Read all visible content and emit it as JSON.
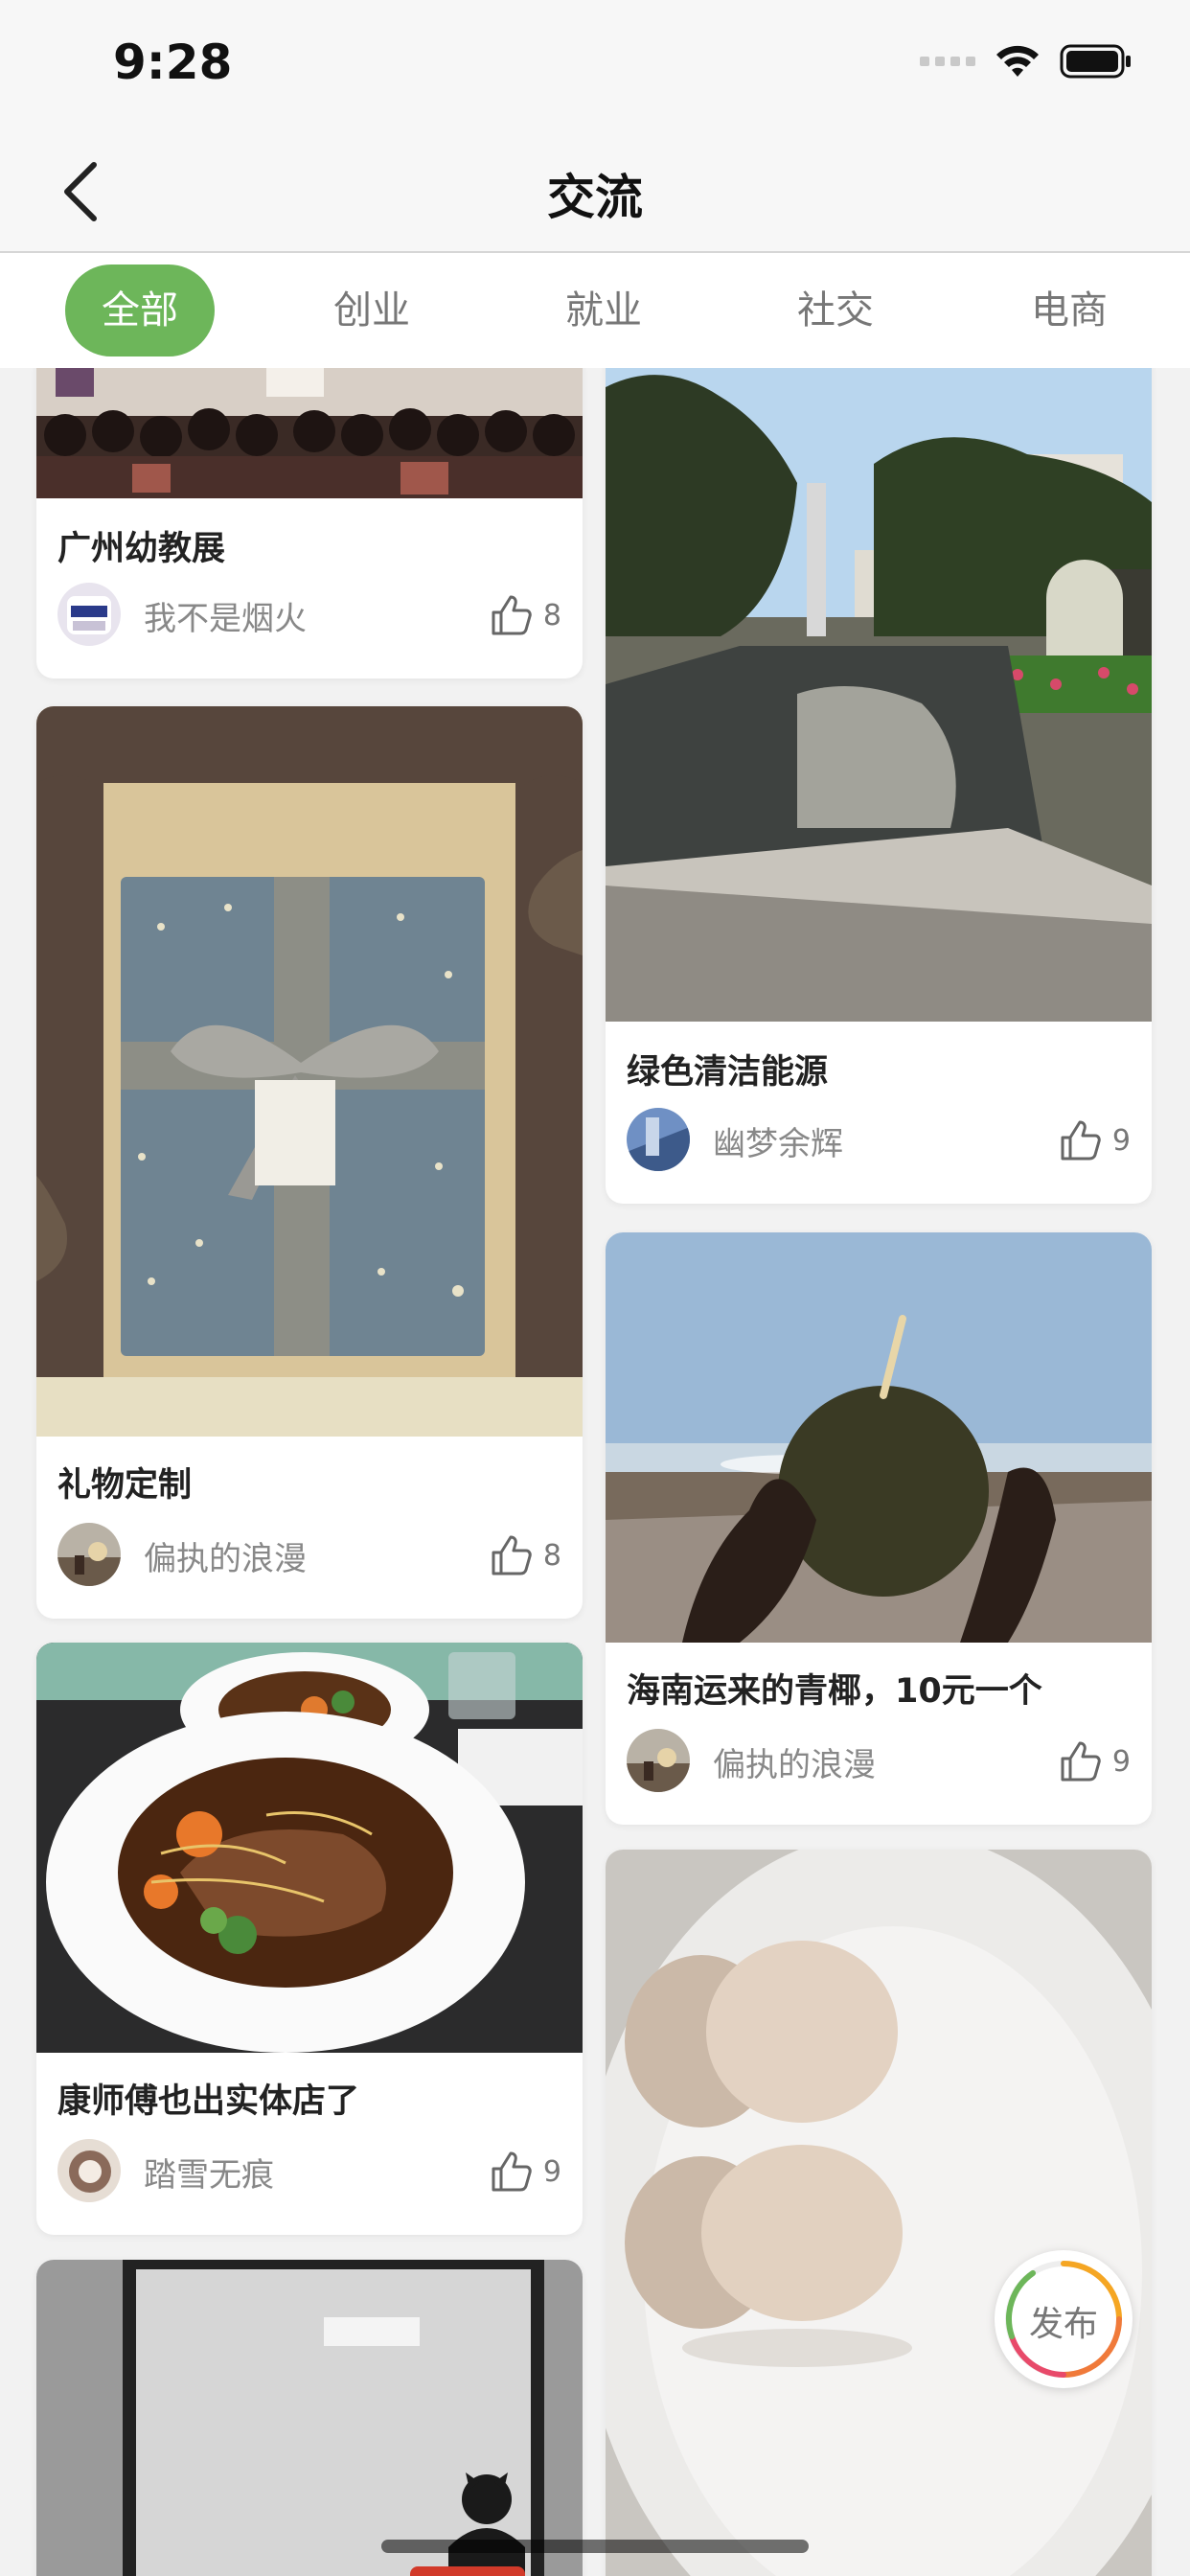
{
  "status_bar": {
    "time": "9:28"
  },
  "nav": {
    "title": "交流"
  },
  "tabs": [
    {
      "label": "全部",
      "active": true
    },
    {
      "label": "创业",
      "active": false
    },
    {
      "label": "就业",
      "active": false
    },
    {
      "label": "社交",
      "active": false
    },
    {
      "label": "电商",
      "active": false
    }
  ],
  "posts": [
    {
      "title": "广州幼教展",
      "author": "我不是烟火",
      "likes": "8"
    },
    {
      "title": "礼物定制",
      "author": "偏执的浪漫",
      "likes": "8"
    },
    {
      "title": "康师傅也出实体店了",
      "author": "踏雪无痕",
      "likes": "9"
    },
    {
      "title": "绿色清洁能源",
      "author": "幽梦余辉",
      "likes": "9"
    },
    {
      "title": "海南运来的青椰，10元一个",
      "author": "偏执的浪漫",
      "likes": "9"
    }
  ],
  "fab": {
    "label": "发布"
  },
  "colors": {
    "accent": "#6db65a"
  },
  "icons": [
    "back-chevron-icon",
    "thumbs-up-icon",
    "wifi-icon",
    "battery-icon"
  ]
}
